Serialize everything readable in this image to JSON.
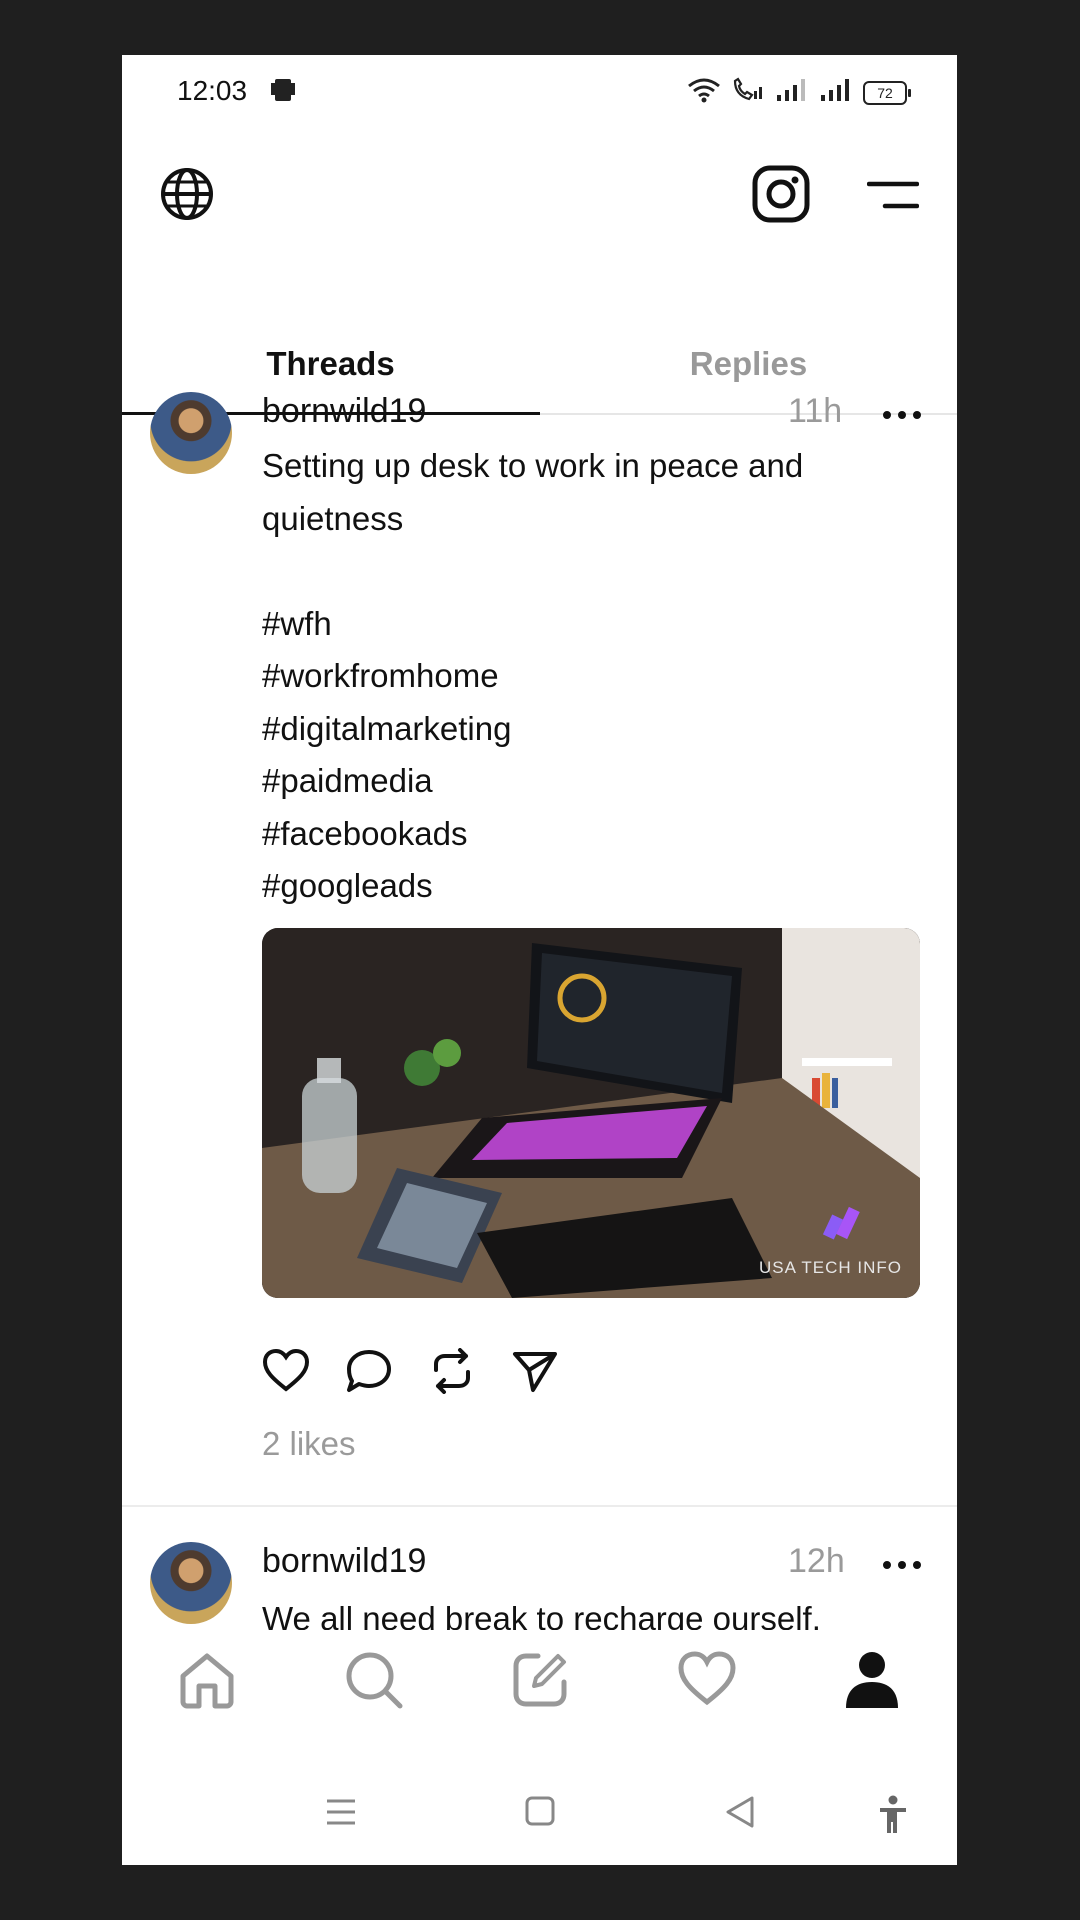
{
  "status_bar": {
    "time": "12:03",
    "battery": "72"
  },
  "tabs": [
    {
      "label": "Threads",
      "active": true
    },
    {
      "label": "Replies",
      "active": false
    }
  ],
  "posts": [
    {
      "username": "bornwild19",
      "time": "11h",
      "text": "Setting up desk to work in peace and quietness",
      "hashtags": [
        "#wfh",
        "#workfromhome",
        "#digitalmarketing",
        "#paidmedia",
        "#facebookads",
        "#googleads"
      ],
      "image_watermark": "USA TECH INFO",
      "likes": "2 likes"
    },
    {
      "username": "bornwild19",
      "time": "12h",
      "text": "We all need break to recharge ourself."
    }
  ],
  "bottom_nav": [
    "home-icon",
    "search-icon",
    "compose-icon",
    "heart-icon",
    "profile-icon"
  ],
  "colors": {
    "text": "#111111",
    "muted": "#9a9a9a",
    "divider": "#ececec",
    "frame": "#1f1f1f"
  }
}
